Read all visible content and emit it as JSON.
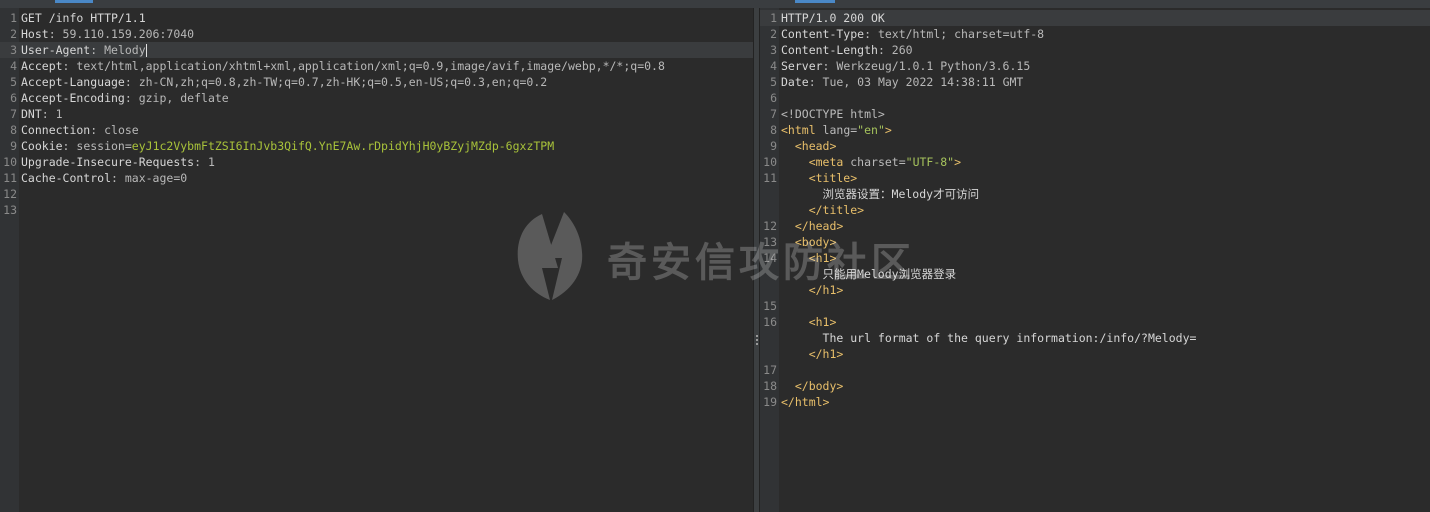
{
  "request": {
    "lines": [
      {
        "num": "1",
        "parts": [
          {
            "t": "GET /info HTTP/1.1",
            "c": "k"
          }
        ]
      },
      {
        "num": "2",
        "parts": [
          {
            "t": "Host",
            "c": "k"
          },
          {
            "t": ": 59.110.159.206:7040",
            "c": "v"
          }
        ]
      },
      {
        "num": "3",
        "parts": [
          {
            "t": "User-Agent",
            "c": "k"
          },
          {
            "t": ": Melody",
            "c": "v"
          }
        ],
        "active": true,
        "cursor": true
      },
      {
        "num": "4",
        "parts": [
          {
            "t": "Accept",
            "c": "k"
          },
          {
            "t": ": text/html,application/xhtml+xml,application/xml;q=0.9,image/avif,image/webp,*/*;q=0.8",
            "c": "v"
          }
        ]
      },
      {
        "num": "5",
        "parts": [
          {
            "t": "Accept-Language",
            "c": "k"
          },
          {
            "t": ": zh-CN,zh;q=0.8,zh-TW;q=0.7,zh-HK;q=0.5,en-US;q=0.3,en;q=0.2",
            "c": "v"
          }
        ]
      },
      {
        "num": "6",
        "parts": [
          {
            "t": "Accept-Encoding",
            "c": "k"
          },
          {
            "t": ": gzip, deflate",
            "c": "v"
          }
        ]
      },
      {
        "num": "7",
        "parts": [
          {
            "t": "DNT",
            "c": "k"
          },
          {
            "t": ": 1",
            "c": "v"
          }
        ]
      },
      {
        "num": "8",
        "parts": [
          {
            "t": "Connection",
            "c": "k"
          },
          {
            "t": ": close",
            "c": "v"
          }
        ]
      },
      {
        "num": "9",
        "parts": [
          {
            "t": "Cookie",
            "c": "k"
          },
          {
            "t": ": session=",
            "c": "v"
          },
          {
            "t": "eyJ1c2VybmFtZSI6InJvb3QifQ.YnE7Aw.rDpidYhjH0yBZyjMZdp-6gxzTPM",
            "c": "cookie"
          }
        ]
      },
      {
        "num": "10",
        "parts": [
          {
            "t": "Upgrade-Insecure-Requests",
            "c": "k"
          },
          {
            "t": ": 1",
            "c": "v"
          }
        ]
      },
      {
        "num": "11",
        "parts": [
          {
            "t": "Cache-Control",
            "c": "k"
          },
          {
            "t": ": max-age=0",
            "c": "v"
          }
        ]
      },
      {
        "num": "12",
        "parts": []
      },
      {
        "num": "13",
        "parts": []
      }
    ]
  },
  "response": {
    "lines": [
      {
        "num": "1",
        "parts": [
          {
            "t": "HTTP/1.0 200 OK",
            "c": "k"
          }
        ],
        "active": true
      },
      {
        "num": "2",
        "parts": [
          {
            "t": "Content-Type",
            "c": "k"
          },
          {
            "t": ": text/html; charset=utf-8",
            "c": "v"
          }
        ]
      },
      {
        "num": "3",
        "parts": [
          {
            "t": "Content-Length",
            "c": "k"
          },
          {
            "t": ": 260",
            "c": "v"
          }
        ]
      },
      {
        "num": "4",
        "parts": [
          {
            "t": "Server",
            "c": "k"
          },
          {
            "t": ": Werkzeug/1.0.1 Python/3.6.15",
            "c": "v"
          }
        ]
      },
      {
        "num": "5",
        "parts": [
          {
            "t": "Date",
            "c": "k"
          },
          {
            "t": ": Tue, 03 May 2022 14:38:11 GMT",
            "c": "v"
          }
        ]
      },
      {
        "num": "6",
        "parts": []
      },
      {
        "num": "7",
        "parts": [
          {
            "t": "<!DOCTYPE html>",
            "c": "attr"
          }
        ]
      },
      {
        "num": "8",
        "parts": [
          {
            "t": "<html ",
            "c": "tag"
          },
          {
            "t": "lang=",
            "c": "attr"
          },
          {
            "t": "\"en\"",
            "c": "str"
          },
          {
            "t": ">",
            "c": "tag"
          }
        ]
      },
      {
        "num": "9",
        "parts": [
          {
            "t": "  <head>",
            "c": "tag"
          }
        ]
      },
      {
        "num": "10",
        "parts": [
          {
            "t": "    <meta ",
            "c": "tag"
          },
          {
            "t": "charset=",
            "c": "attr"
          },
          {
            "t": "\"UTF-8\"",
            "c": "str"
          },
          {
            "t": ">",
            "c": "tag"
          }
        ]
      },
      {
        "num": "11",
        "parts": [
          {
            "t": "    <title>",
            "c": "tag"
          }
        ]
      },
      {
        "num": "",
        "parts": [
          {
            "t": "      浏览器设置：Melody才可访问",
            "c": "k"
          }
        ]
      },
      {
        "num": "",
        "parts": [
          {
            "t": "    </title>",
            "c": "tag"
          }
        ]
      },
      {
        "num": "12",
        "parts": [
          {
            "t": "  </head>",
            "c": "tag"
          }
        ]
      },
      {
        "num": "13",
        "parts": [
          {
            "t": "  <body>",
            "c": "tag"
          }
        ]
      },
      {
        "num": "14",
        "parts": [
          {
            "t": "    <h1>",
            "c": "tag"
          }
        ]
      },
      {
        "num": "",
        "parts": [
          {
            "t": "      只能用Melody浏览器登录",
            "c": "k"
          }
        ]
      },
      {
        "num": "",
        "parts": [
          {
            "t": "    </h1>",
            "c": "tag"
          }
        ]
      },
      {
        "num": "15",
        "parts": []
      },
      {
        "num": "16",
        "parts": [
          {
            "t": "    <h1>",
            "c": "tag"
          }
        ]
      },
      {
        "num": "",
        "parts": [
          {
            "t": "      The url format of the query information:/info/?Melody=",
            "c": "k"
          }
        ]
      },
      {
        "num": "",
        "parts": [
          {
            "t": "    </h1>",
            "c": "tag"
          }
        ]
      },
      {
        "num": "17",
        "parts": []
      },
      {
        "num": "18",
        "parts": [
          {
            "t": "  </body>",
            "c": "tag"
          }
        ]
      },
      {
        "num": "19",
        "parts": [
          {
            "t": "</html>",
            "c": "tag"
          }
        ]
      }
    ]
  },
  "watermark": {
    "text": "奇安信攻防社区"
  }
}
